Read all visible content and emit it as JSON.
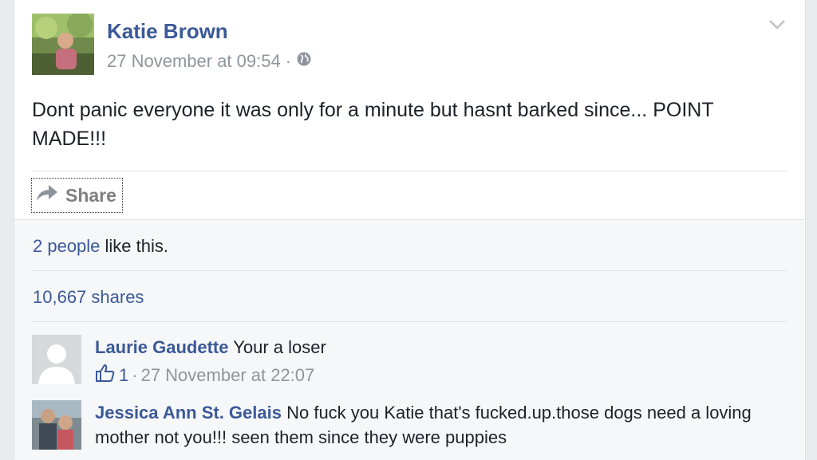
{
  "post": {
    "author": "Katie Brown",
    "timestamp": "27 November at 09:54",
    "separator": "·",
    "audience_icon": "globe-icon",
    "text": "Dont panic everyone it was only for a minute but hasnt barked since... POINT MADE!!!",
    "share_label": "Share"
  },
  "footer": {
    "likes_link": "2 people",
    "likes_suffix": " like this.",
    "shares": "10,667 shares"
  },
  "comments": [
    {
      "author": "Laurie Gaudette",
      "text": "Your a loser",
      "like_count": "1",
      "separator": "·",
      "timestamp": "27 November at 22:07"
    },
    {
      "author": "Jessica Ann St. Gelais",
      "text": "No fuck you Katie that's fucked.up.those dogs need a loving mother not you!!! seen them since they were puppies"
    }
  ],
  "colors": {
    "link": "#3b5998",
    "meta": "#90949c",
    "text": "#1d2129",
    "background": "#e9ebee"
  }
}
